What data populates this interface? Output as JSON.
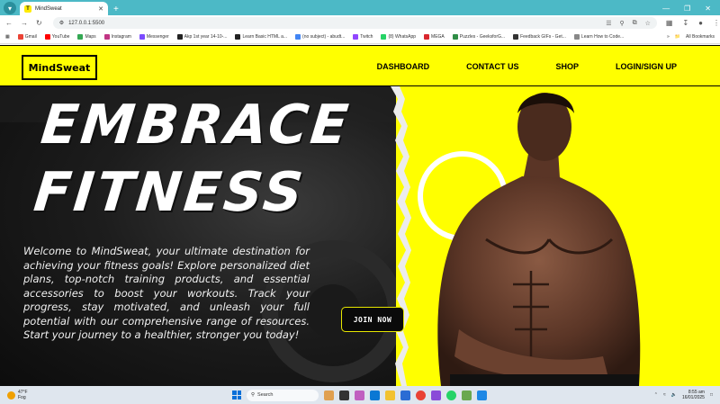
{
  "browser": {
    "tab_title": "MindSweat",
    "tab_favicon": "T",
    "url": "127.0.0.1:5500",
    "bookmarks": [
      {
        "label": "Gmail",
        "color": "#ea4335"
      },
      {
        "label": "YouTube",
        "color": "#ff0000"
      },
      {
        "label": "Maps",
        "color": "#34a853"
      },
      {
        "label": "Instagram",
        "color": "#c13584"
      },
      {
        "label": "Messenger",
        "color": "#7b4bff"
      },
      {
        "label": "Akp 1st year 14-10-...",
        "color": "#222222"
      },
      {
        "label": "Learn Basic HTML a...",
        "color": "#222222"
      },
      {
        "label": "(no subject) - abudt...",
        "color": "#4285f4"
      },
      {
        "label": "Twitch",
        "color": "#9146ff"
      },
      {
        "label": "(8) WhatsApp",
        "color": "#25d366"
      },
      {
        "label": "MEGA",
        "color": "#d9272e"
      },
      {
        "label": "Puzzles - GeeksforG...",
        "color": "#2f8d46"
      },
      {
        "label": "Feedback GIFs - Get...",
        "color": "#333333"
      },
      {
        "label": "Learn How to Code...",
        "color": "#888888"
      }
    ],
    "all_bookmarks_label": "All Bookmarks"
  },
  "site": {
    "logo": "MindSweat",
    "nav": {
      "dashboard": "DASHBOARD",
      "contact": "CONTACT US",
      "shop": "SHOP",
      "login": "LOGIN/SIGN UP"
    },
    "hero": {
      "headline_line1": "EMBRACE",
      "headline_line2": "FITNESS",
      "blurb": "Welcome to MindSweat, your ultimate destination for achieving your fitness goals! Explore personalized diet plans, top-notch training products, and essential accessories to boost your workouts. Track your progress, stay motivated, and unleash your full potential with our comprehensive range of resources. Start your journey to a healthier, stronger you today!",
      "join_button": "JOIN NOW"
    },
    "colors": {
      "accent": "#ffff00",
      "dark": "#111111"
    }
  },
  "taskbar": {
    "weather_temp": "47°F",
    "weather_desc": "Fog",
    "search_placeholder": "Search",
    "time": "8:55 am",
    "date": "16/01/2025"
  }
}
